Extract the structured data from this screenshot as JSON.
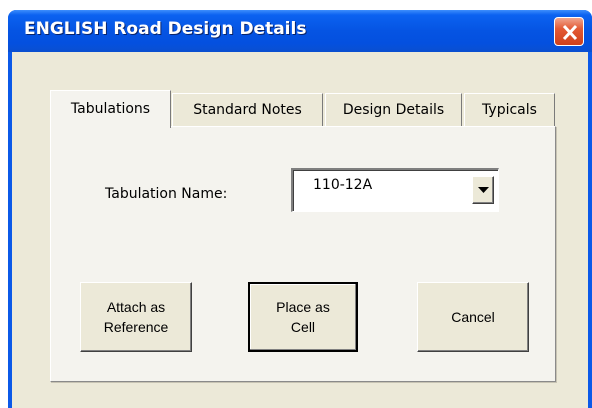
{
  "window": {
    "title": "ENGLISH Road Design Details",
    "close_icon": "close-icon"
  },
  "tabs": [
    {
      "label": "Tabulations",
      "active": true
    },
    {
      "label": "Standard Notes",
      "active": false
    },
    {
      "label": "Design Details",
      "active": false
    },
    {
      "label": "Typicals",
      "active": false
    }
  ],
  "form": {
    "tabulation_label": "Tabulation Name:",
    "tabulation_value": "110-12A"
  },
  "buttons": {
    "attach_reference": "Attach as\nReference",
    "place_cell": "Place as\nCell",
    "cancel": "Cancel"
  },
  "colors": {
    "titlebar": "#0554e3",
    "dialog_bg": "#ece9d8",
    "close_button": "#e35a35"
  }
}
